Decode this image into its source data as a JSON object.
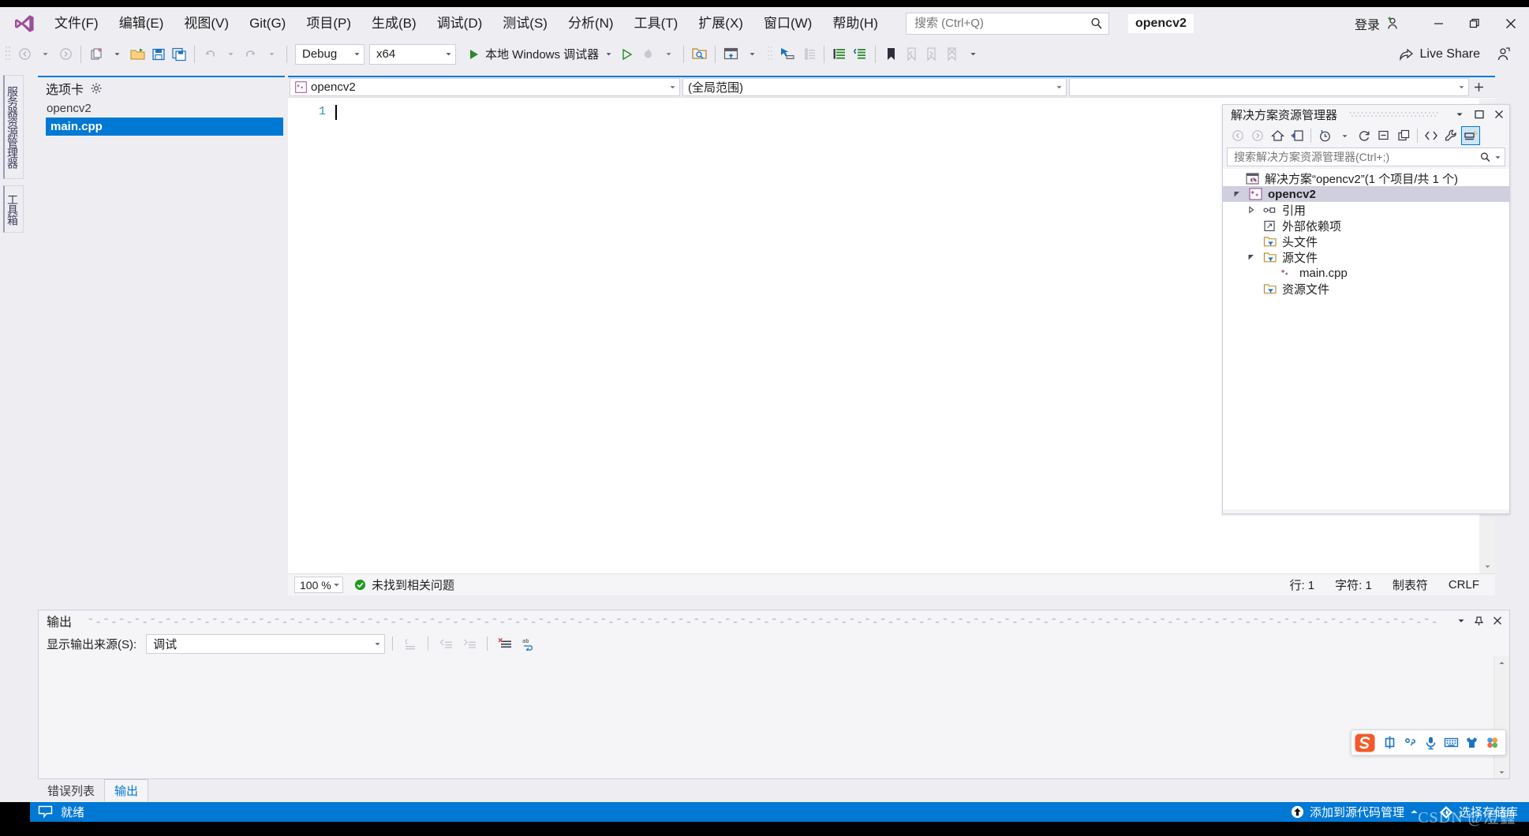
{
  "app": {
    "product": "Visual Studio",
    "project_chip": "opencv2"
  },
  "menubar": {
    "items": [
      {
        "label": "文件(F)"
      },
      {
        "label": "编辑(E)"
      },
      {
        "label": "视图(V)"
      },
      {
        "label": "Git(G)"
      },
      {
        "label": "项目(P)"
      },
      {
        "label": "生成(B)"
      },
      {
        "label": "调试(D)"
      },
      {
        "label": "测试(S)"
      },
      {
        "label": "分析(N)"
      },
      {
        "label": "工具(T)"
      },
      {
        "label": "扩展(X)"
      },
      {
        "label": "窗口(W)"
      },
      {
        "label": "帮助(H)"
      }
    ],
    "search_placeholder": "搜索 (Ctrl+Q)",
    "signin_label": "登录"
  },
  "window_controls": {
    "minimize": "–",
    "restore": "❐",
    "close": "✕"
  },
  "toolbar": {
    "config": "Debug",
    "platform": "x64",
    "run_label": "本地 Windows 调试器",
    "live_share_label": "Live Share"
  },
  "left_dock": {
    "tabs": [
      {
        "label": "服务器资源管理器"
      },
      {
        "label": "工具箱"
      }
    ]
  },
  "left_pane": {
    "title": "选项卡",
    "items": [
      {
        "label": "opencv2",
        "selected": false
      },
      {
        "label": "main.cpp",
        "selected": true
      }
    ]
  },
  "editor": {
    "nav_file": "opencv2",
    "nav_scope": "(全局范围)",
    "nav_member": "",
    "line_numbers": [
      "1"
    ],
    "code_lines": [
      ""
    ],
    "zoom_level": "100 %",
    "problem_status": "未找到相关问题",
    "status_line": "行: 1",
    "status_char": "字符: 1",
    "status_tabs": "制表符",
    "status_eol": "CRLF"
  },
  "solution_explorer": {
    "title": "解决方案资源管理器",
    "search_placeholder": "搜索解决方案资源管理器(Ctrl+;)",
    "tree": [
      {
        "label": "解决方案“opencv2”(1 个项目/共 1 个)",
        "depth": 0,
        "icon": "solution-icon",
        "twisty": "none",
        "bold": false,
        "selected": false
      },
      {
        "label": "opencv2",
        "depth": 1,
        "icon": "cpp-project-icon",
        "twisty": "expanded",
        "bold": true,
        "selected": true
      },
      {
        "label": "引用",
        "depth": 2,
        "icon": "references-icon",
        "twisty": "collapsed",
        "bold": false,
        "selected": false
      },
      {
        "label": "外部依赖项",
        "depth": 2,
        "icon": "external-deps-icon",
        "twisty": "none",
        "bold": false,
        "selected": false
      },
      {
        "label": "头文件",
        "depth": 2,
        "icon": "filter-folder-icon",
        "twisty": "none",
        "bold": false,
        "selected": false
      },
      {
        "label": "源文件",
        "depth": 2,
        "icon": "filter-folder-icon",
        "twisty": "expanded",
        "bold": false,
        "selected": false
      },
      {
        "label": "main.cpp",
        "depth": 3,
        "icon": "cpp-file-icon",
        "twisty": "none",
        "bold": false,
        "selected": false
      },
      {
        "label": "资源文件",
        "depth": 2,
        "icon": "filter-folder-icon",
        "twisty": "none",
        "bold": false,
        "selected": false
      }
    ]
  },
  "output_panel": {
    "title": "输出",
    "source_label": "显示输出来源(S):",
    "source_value": "调试",
    "content": ""
  },
  "bottom_tabs": [
    {
      "label": "错误列表",
      "active": false
    },
    {
      "label": "输出",
      "active": true
    }
  ],
  "statusbar": {
    "ready": "就绪",
    "source_control": "添加到源代码管理",
    "repository": "选择存储库",
    "watermark": "CSDN @澄鑫"
  },
  "ime": {
    "name": "sogou-ime",
    "icons": [
      "sogou-logo-icon",
      "chinese-mode-icon",
      "punctuation-icon",
      "microphone-icon",
      "soft-keyboard-icon",
      "skin-icon",
      "apps-icon"
    ]
  },
  "colors": {
    "accent": "#0078d4",
    "chrome": "#eeeef2",
    "selection": "#0078d4",
    "tree_selection": "#cfcfdf",
    "green_run": "#3a8a3a",
    "link": "#0078d4"
  }
}
